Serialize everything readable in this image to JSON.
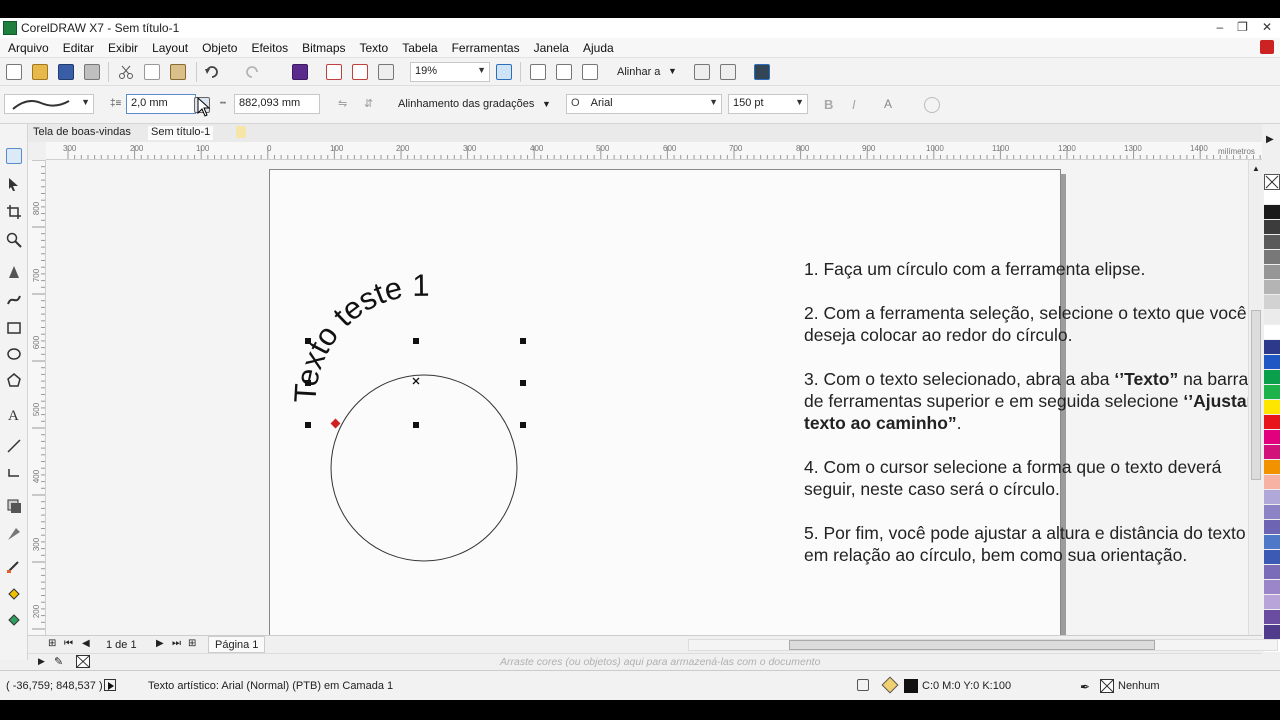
{
  "window": {
    "title": "CorelDRAW X7 - Sem título-1",
    "minimize": "–",
    "restore": "❐",
    "close": "✕"
  },
  "menu": [
    "Arquivo",
    "Editar",
    "Exibir",
    "Layout",
    "Objeto",
    "Efeitos",
    "Bitmaps",
    "Texto",
    "Tabela",
    "Ferramentas",
    "Janela",
    "Ajuda"
  ],
  "toolbar": {
    "zoom_value": "19%",
    "snap_label": "Alinhar a"
  },
  "propbar": {
    "offset_value": "2,0 mm",
    "distance_value": "882,093 mm",
    "gradient_align_label": "Alinhamento das gradações",
    "font_name": "Arial",
    "font_size": "150 pt",
    "font_glyph": "O"
  },
  "tabs": [
    "Tela de boas-vindas",
    "Sem título-1"
  ],
  "ruler": {
    "h_ticks": [
      "300",
      "200",
      "100",
      "0",
      "100",
      "200",
      "300",
      "400",
      "500",
      "600",
      "700",
      "800",
      "900",
      "1000",
      "1100",
      "1200",
      "1300",
      "1400"
    ],
    "h_unit": "milímetros",
    "v_ticks": [
      "800",
      "700",
      "600",
      "500",
      "400",
      "300",
      "200"
    ],
    "v_unit": "milímetros"
  },
  "canvas": {
    "curved_text": "Texto teste 1",
    "instructions": [
      {
        "parts": [
          {
            "t": "1. Faça um círculo com a ferramenta elipse.",
            "b": false
          }
        ]
      },
      {
        "parts": [
          {
            "t": "2. Com a ferramenta seleção, selecione o texto que você deseja colocar ao redor do círculo.",
            "b": false
          }
        ]
      },
      {
        "parts": [
          {
            "t": "3. Com o texto selecionado, abra a aba ",
            "b": false
          },
          {
            "t": "‘’Texto”",
            "b": true
          },
          {
            "t": " na barra de ferramentas superior e em seguida selecione ",
            "b": false
          },
          {
            "t": "‘’Ajustar texto ao caminho”",
            "b": true
          },
          {
            "t": ".",
            "b": false
          }
        ]
      },
      {
        "parts": [
          {
            "t": "4. Com o cursor selecione a forma que o texto deverá seguir, neste caso será o círculo.",
            "b": false
          }
        ]
      },
      {
        "parts": [
          {
            "t": "5. Por fim, você pode ajustar a altura e distância do texto em relação ao círculo, bem como sua orientação.",
            "b": false
          }
        ]
      }
    ]
  },
  "pagenav": {
    "page_count": "1 de 1",
    "page_tab": "Página 1"
  },
  "docbar": {
    "hint": "Arraste cores (ou objetos) aqui para armazená-las com o documento"
  },
  "status": {
    "coords": "( -36,759; 848,537 )",
    "object_info": "Texto artístico: Arial (Normal) (PTB) em Camada 1",
    "fill_info": "C:0 M:0 Y:0 K:100",
    "outline_info": "Nenhum"
  },
  "palette": [
    "#ffffff",
    "#1a1a1a",
    "#3c3c3c",
    "#5a5a5a",
    "#787878",
    "#969696",
    "#b4b4b4",
    "#d2d2d2",
    "#ebebeb",
    "#ffffff",
    "#2d3a8c",
    "#1f58c4",
    "#0aa04b",
    "#1db34a",
    "#ffe600",
    "#e8161b",
    "#e3007f",
    "#d2127a",
    "#f39200",
    "#f7b2a4",
    "#b0a8d8",
    "#8c82c6",
    "#6e64b4",
    "#5078c8",
    "#3c5ab4",
    "#7a6cb8",
    "#9a86c8",
    "#b8a4d8",
    "#6a4ca0",
    "#503c8c"
  ]
}
